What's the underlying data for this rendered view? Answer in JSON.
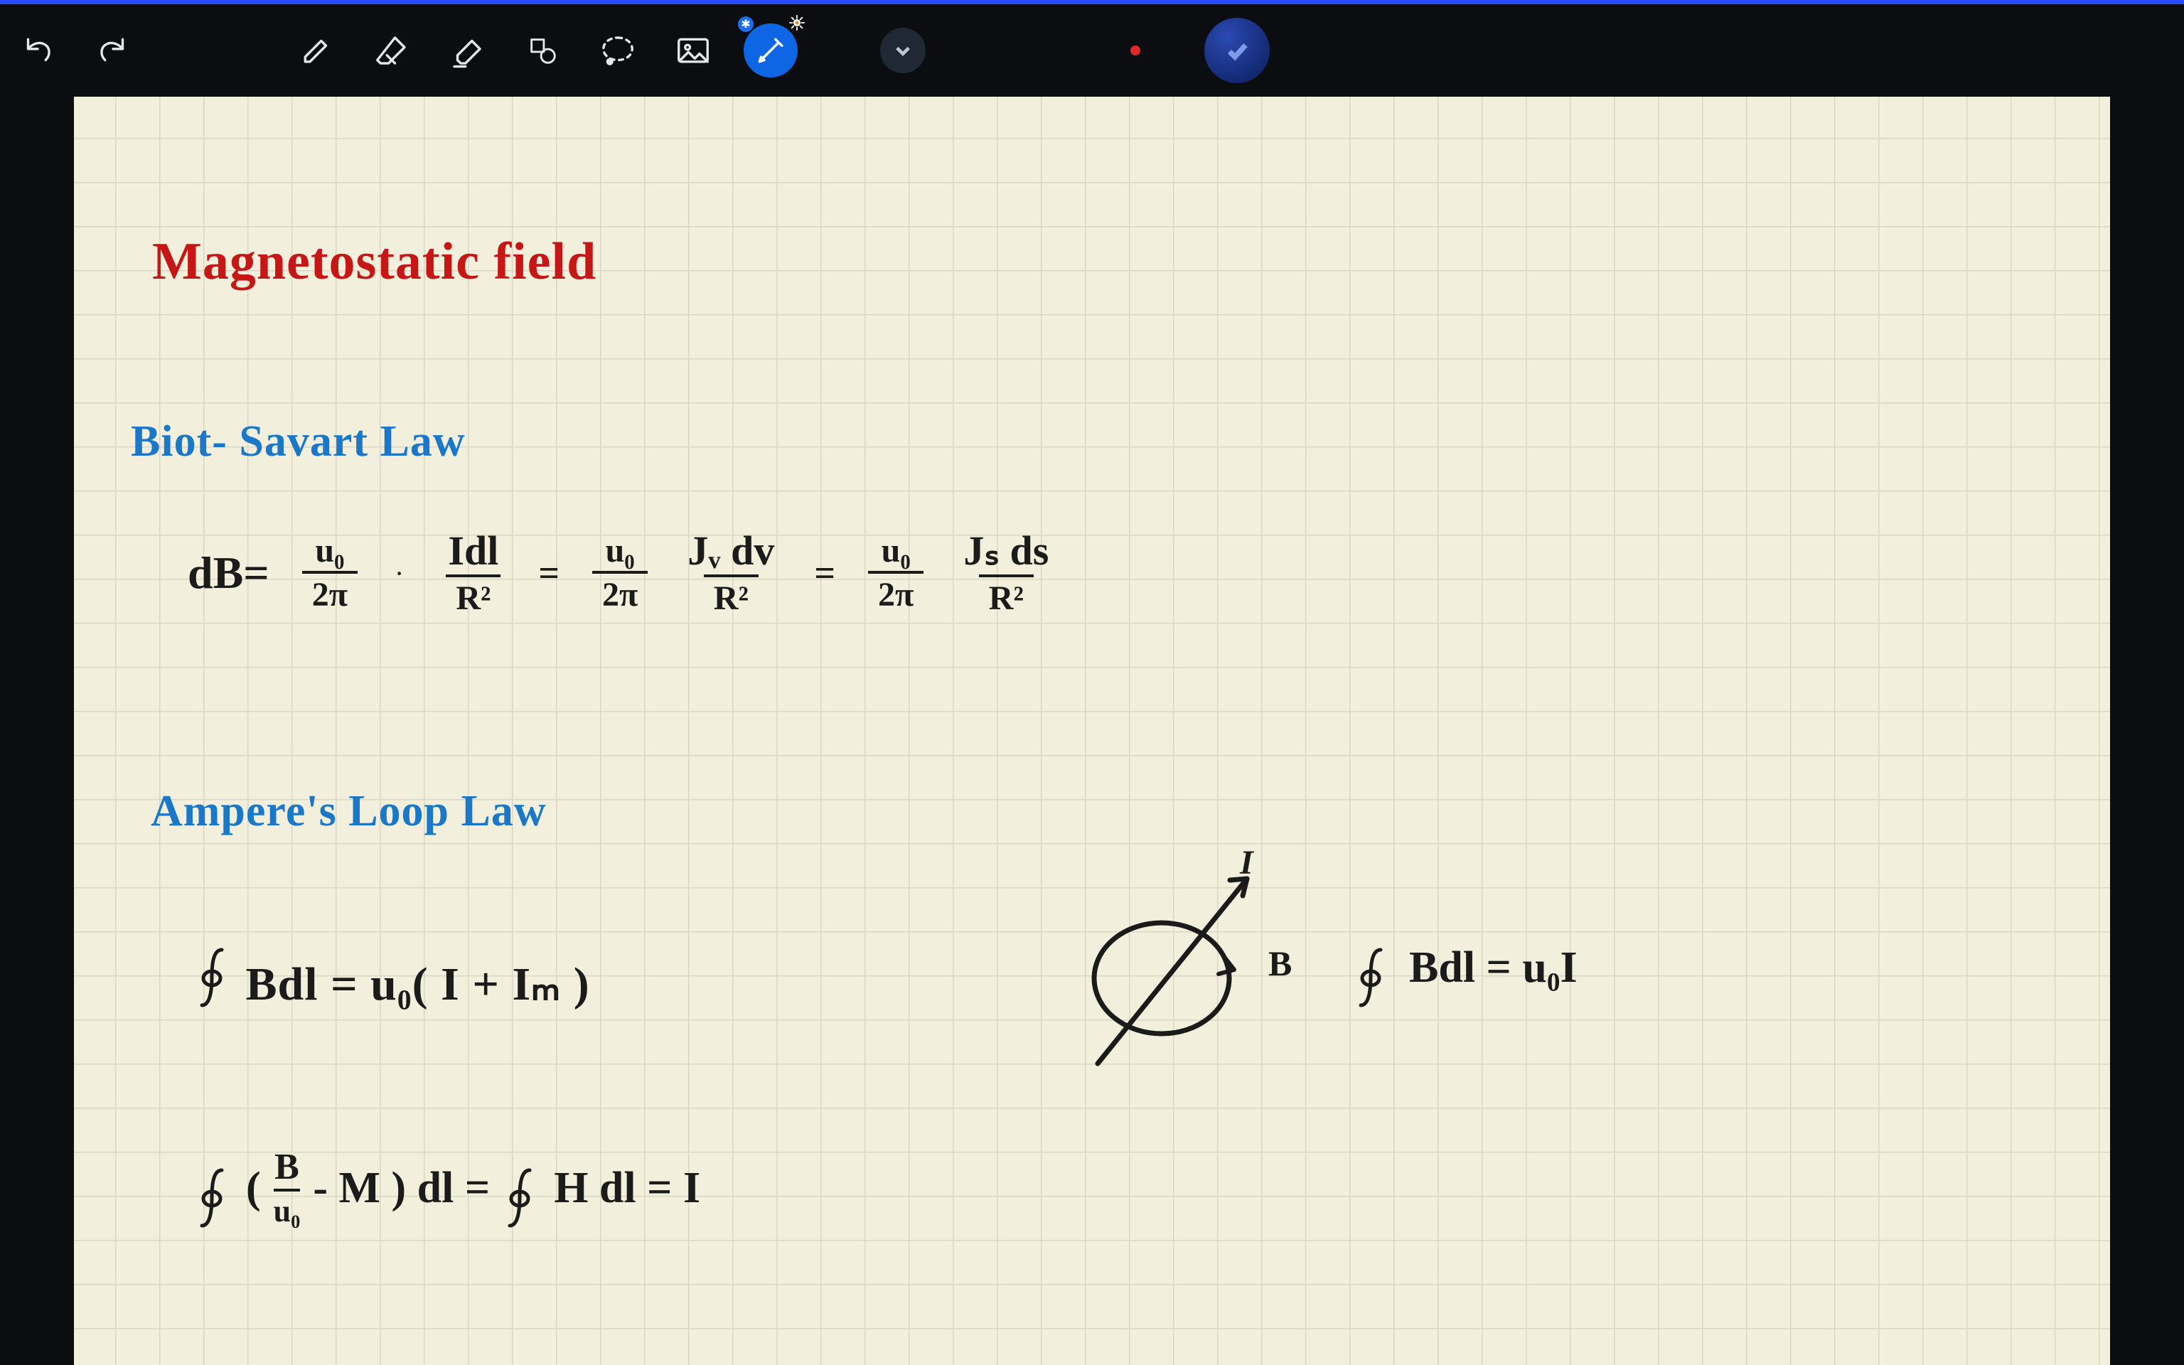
{
  "toolbar": {
    "tools": [
      {
        "name": "undo-icon"
      },
      {
        "name": "redo-icon"
      },
      {
        "name": "pen-icon"
      },
      {
        "name": "eraser-icon"
      },
      {
        "name": "highlighter-icon"
      },
      {
        "name": "shape-icon"
      },
      {
        "name": "lasso-icon"
      },
      {
        "name": "image-icon"
      },
      {
        "name": "laser-pointer-icon",
        "active": true
      },
      {
        "name": "chevron-down-icon"
      },
      {
        "name": "record-indicator"
      },
      {
        "name": "mode-toggle"
      }
    ]
  },
  "page": {
    "title": "Magnetostatic  field",
    "section1": "Biot- Savart  Law",
    "section2": "Ampere's  Loop  Law",
    "eq1": {
      "lhs": "dB=",
      "t1_num": "u₀",
      "t1_den": "2π",
      "dot": "·",
      "t2_num": "Idl",
      "t2_den": "R²",
      "eq": "=",
      "t3_num": "u₀",
      "t3_den": "2π",
      "t4_num": "Jᵥ dv",
      "t4_den": "R²",
      "eq2": "=",
      "t5_num": "u₀",
      "t5_den": "2π",
      "t6_num": "Jₛ ds",
      "t6_den": "R²"
    },
    "eq2": "Bdl = u₀( I + Iₘ )",
    "eq3_left": "(",
    "eq3_frac_num": "B",
    "eq3_frac_den": "u₀",
    "eq3_mid": " - M ) dl  =  ",
    "eq3_H": " H dl  =  I",
    "diagram": {
      "B_label": "B",
      "I_label": "I"
    },
    "eq_right": "Bdl  =  u₀I"
  }
}
